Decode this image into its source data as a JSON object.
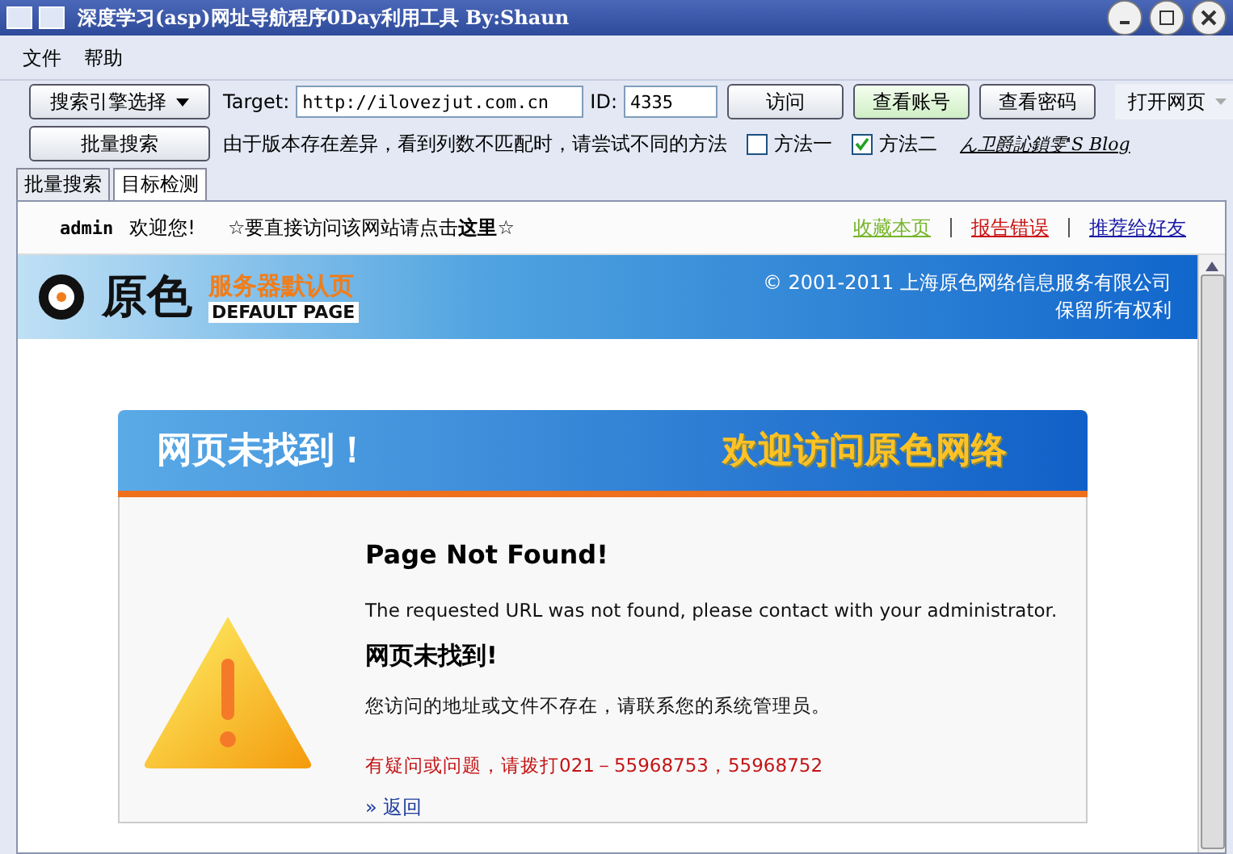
{
  "window": {
    "title": "深度学习(asp)网址导航程序0Day利用工具 By:Shaun"
  },
  "menu": [
    {
      "label": "文件"
    },
    {
      "label": "帮助"
    }
  ],
  "toolbar": {
    "engine_select": "搜索引擎选择",
    "batch_button": "批量搜索",
    "target_label": "Target:",
    "target_value": "http://ilovezjut.com.cn",
    "id_label": "ID:",
    "id_value": "4335",
    "buttons": [
      {
        "label": "访问",
        "highlighted": false
      },
      {
        "label": "查看账号",
        "highlighted": true
      },
      {
        "label": "查看密码",
        "highlighted": false
      }
    ],
    "open_page": "打开网页",
    "note": "由于版本存在差异，看到列数不匹配时，请尝试不同的方法",
    "methods": [
      {
        "label": "方法一",
        "checked": false
      },
      {
        "label": "方法二",
        "checked": true
      }
    ],
    "blog_link": "ん卫爵訫鎖雯'S Blog"
  },
  "tabs": [
    {
      "label": "批量搜索",
      "selected": false
    },
    {
      "label": "目标检测",
      "selected": true
    }
  ],
  "browser": {
    "user": "admin",
    "welcome": "欢迎您!",
    "visit_note": "☆要直接访问该网站请点击**这里**☆",
    "links": [
      {
        "label": "收藏本页",
        "color": "#76b52a"
      },
      {
        "label": "报告错误",
        "color": "#cc1111"
      },
      {
        "label": "推荐给好友",
        "color": "#1a1aa6"
      }
    ],
    "logo": "原色",
    "banner_title": "服务器默认页",
    "banner_subtitle": "DEFAULT PAGE",
    "copyright": "© 2001-2011 上海原色网络信息服务有限公司",
    "rights": "保留所有权利",
    "box_header": "网页未找到！",
    "box_slogan": "欢迎访问原色网络",
    "heading": "Page Not Found!",
    "message": "The requested URL was not found, please contact with your administrator.",
    "heading_cn": "网页未找到!",
    "message_cn": "您访问的地址或文件不存在，请联系您的系统管理员。",
    "contact": "有疑问或问题，请拨打021－55968753，55968752",
    "back_link": "» 返回"
  }
}
